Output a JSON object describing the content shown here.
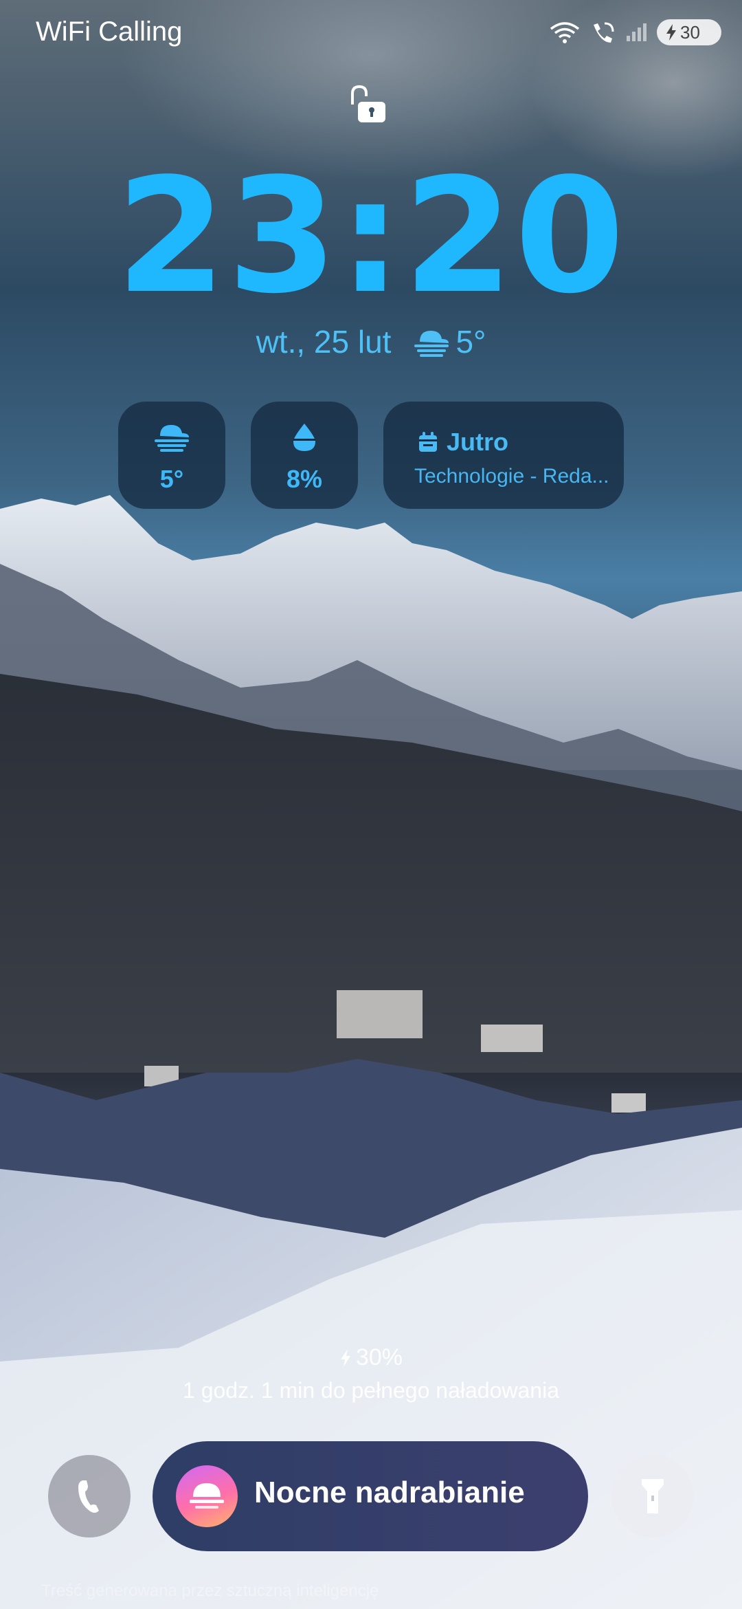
{
  "status_bar": {
    "carrier": "WiFi Calling",
    "battery": "30",
    "icons": [
      "wifi-icon",
      "wifi-calling-icon",
      "signal-icon",
      "charging-bolt-icon"
    ]
  },
  "lock_icon": "unlocked-padlock-icon",
  "clock": {
    "time": "23:20",
    "date": "wt., 25 lut",
    "weather_icon": "fog-icon",
    "temperature": "5°"
  },
  "widgets": {
    "weather": {
      "icon": "fog-icon",
      "value": "5°"
    },
    "precipitation": {
      "icon": "raindrop-icon",
      "value": "8%"
    },
    "calendar": {
      "icon": "calendar-icon",
      "title": "Jutro",
      "subtitle": "Technologie - Reda..."
    }
  },
  "charging": {
    "percent": "30%",
    "eta": "1 godz. 1 min do pełnego naładowania"
  },
  "shortcuts": {
    "left": "phone-icon",
    "right": "flashlight-icon"
  },
  "routine": {
    "icon": "sunset-icon",
    "label": "Nocne nadrabianie"
  },
  "footer": "Treść generowana przez sztuczną inteligencję",
  "colors": {
    "accent": "#1fb8ff",
    "widget_bg": "#162c42",
    "routine_bg": "#34406b"
  }
}
